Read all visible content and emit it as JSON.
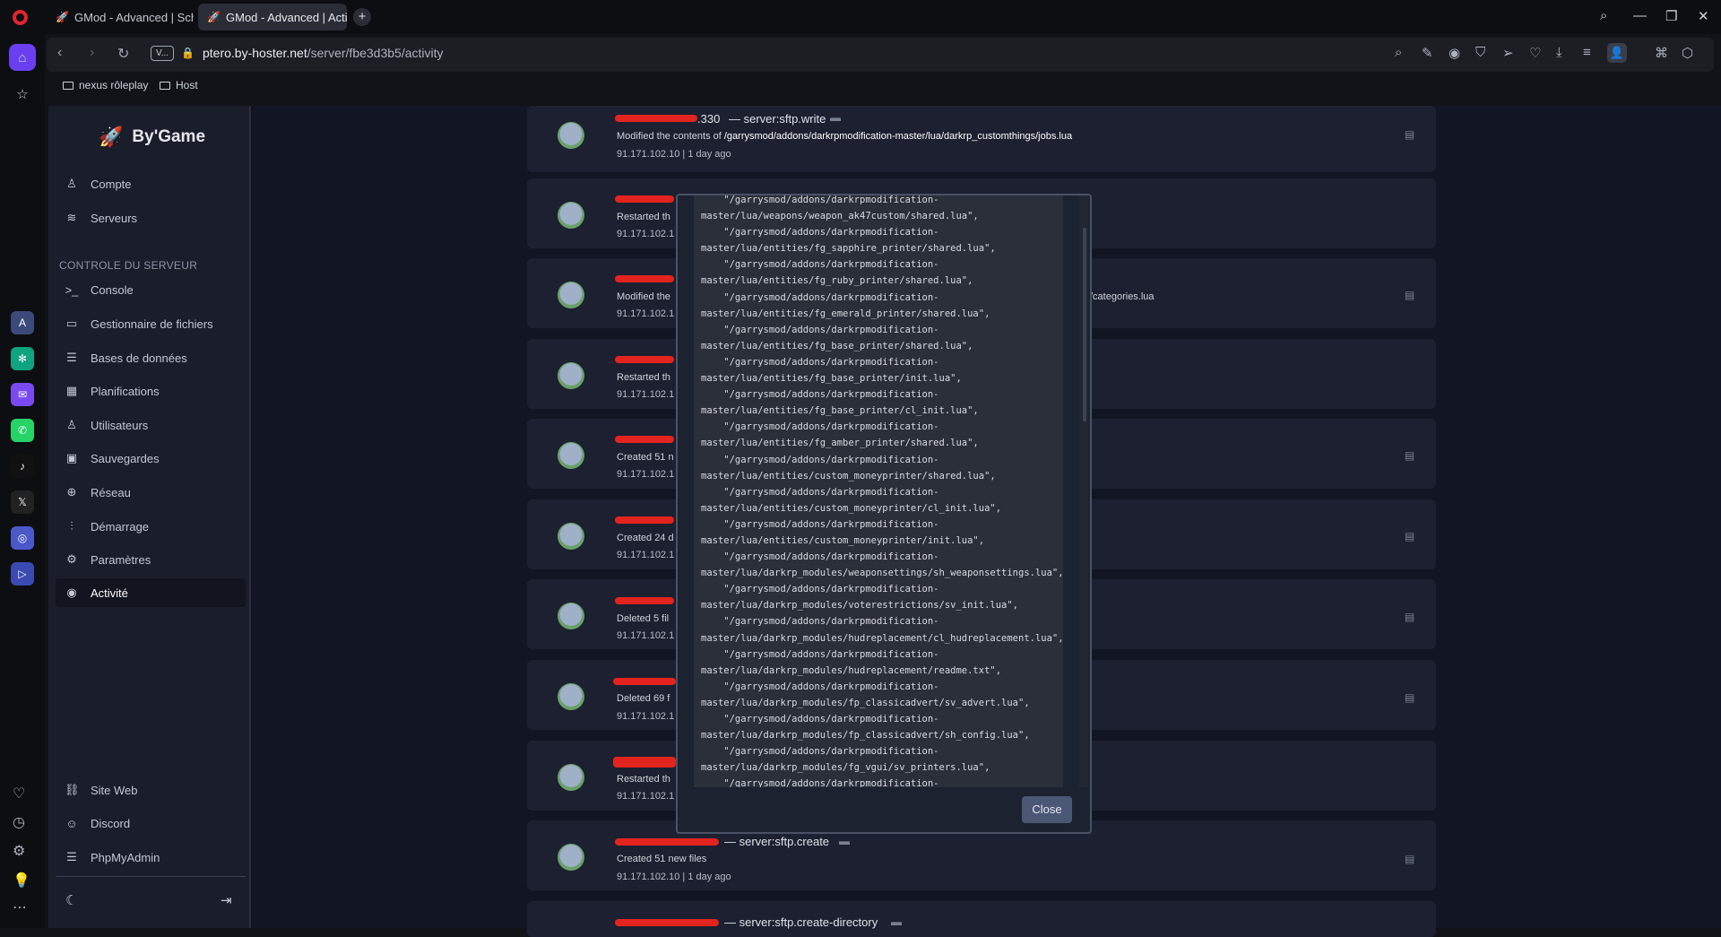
{
  "browser": {
    "tabs": [
      {
        "label": "GMod - Advanced | Sched"
      },
      {
        "label": "GMod - Advanced | Activ"
      }
    ],
    "new_tab": "+",
    "vpn_badge": "V...",
    "url_host": "ptero.by-hoster.net",
    "url_path": "/server/fbe3d3b5/activity",
    "bookmarks": [
      {
        "label": "nexus rôleplay"
      },
      {
        "label": "Host"
      }
    ]
  },
  "panel": {
    "brand": "By'Game",
    "nav_top": [
      {
        "label": "Compte"
      },
      {
        "label": "Serveurs"
      }
    ],
    "section_label": "CONTROLE DU SERVEUR",
    "nav_server": [
      {
        "label": "Console"
      },
      {
        "label": "Gestionnaire de fichiers"
      },
      {
        "label": "Bases de données"
      },
      {
        "label": "Planifications"
      },
      {
        "label": "Utilisateurs"
      },
      {
        "label": "Sauvegardes"
      },
      {
        "label": "Réseau"
      },
      {
        "label": "Démarrage"
      },
      {
        "label": "Paramètres"
      },
      {
        "label": "Activité"
      }
    ],
    "nav_bottom": [
      {
        "label": "Site Web"
      },
      {
        "label": "Discord"
      },
      {
        "label": "PhpMyAdmin"
      }
    ]
  },
  "activity": [
    {
      "user_suffix": ".330",
      "event": "— server:sftp.write",
      "desc_prefix": "Modified the contents of ",
      "desc_path": "/garrysmod/addons/darkrpmodification-master/lua/darkrp_customthings/jobs.lua",
      "meta": "91.171.102.10 | 1 day ago"
    },
    {
      "desc": "Restarted th",
      "meta": "91.171.102.1"
    },
    {
      "desc": "Modified the",
      "desc_tail": "/categories.lua",
      "meta": "91.171.102.1"
    },
    {
      "desc": "Restarted th",
      "meta": "91.171.102.1"
    },
    {
      "desc": "Created 51 n",
      "meta": "91.171.102.1"
    },
    {
      "desc": "Created 24 d",
      "meta": "91.171.102.1"
    },
    {
      "desc": "Deleted 5 fil",
      "meta": "91.171.102.1"
    },
    {
      "desc": "Deleted 69 f",
      "meta": "91.171.102.1"
    },
    {
      "desc": "Restarted th",
      "meta": "91.171.102.1"
    },
    {
      "user_suffix": ".330",
      "event": "— server:sftp.create",
      "desc": "Created 51 new files",
      "meta": "91.171.102.10 | 1 day ago"
    },
    {
      "event": "— server:sftp.create-directory"
    }
  ],
  "modal": {
    "code": "    \"/garrysmod/addons/darkrpmodification-\nmaster/lua/weapons/weapon_ak47custom/shared.lua\",\n    \"/garrysmod/addons/darkrpmodification-\nmaster/lua/entities/fg_sapphire_printer/shared.lua\",\n    \"/garrysmod/addons/darkrpmodification-\nmaster/lua/entities/fg_ruby_printer/shared.lua\",\n    \"/garrysmod/addons/darkrpmodification-\nmaster/lua/entities/fg_emerald_printer/shared.lua\",\n    \"/garrysmod/addons/darkrpmodification-\nmaster/lua/entities/fg_base_printer/shared.lua\",\n    \"/garrysmod/addons/darkrpmodification-\nmaster/lua/entities/fg_base_printer/init.lua\",\n    \"/garrysmod/addons/darkrpmodification-\nmaster/lua/entities/fg_base_printer/cl_init.lua\",\n    \"/garrysmod/addons/darkrpmodification-\nmaster/lua/entities/fg_amber_printer/shared.lua\",\n    \"/garrysmod/addons/darkrpmodification-\nmaster/lua/entities/custom_moneyprinter/shared.lua\",\n    \"/garrysmod/addons/darkrpmodification-\nmaster/lua/entities/custom_moneyprinter/cl_init.lua\",\n    \"/garrysmod/addons/darkrpmodification-\nmaster/lua/entities/custom_moneyprinter/init.lua\",\n    \"/garrysmod/addons/darkrpmodification-\nmaster/lua/darkrp_modules/weaponsettings/sh_weaponsettings.lua\",\n    \"/garrysmod/addons/darkrpmodification-\nmaster/lua/darkrp_modules/voterestrictions/sv_init.lua\",\n    \"/garrysmod/addons/darkrpmodification-\nmaster/lua/darkrp_modules/hudreplacement/cl_hudreplacement.lua\",\n    \"/garrysmod/addons/darkrpmodification-\nmaster/lua/darkrp_modules/hudreplacement/readme.txt\",\n    \"/garrysmod/addons/darkrpmodification-\nmaster/lua/darkrp_modules/fp_classicadvert/sv_advert.lua\",\n    \"/garrysmod/addons/darkrpmodification-\nmaster/lua/darkrp_modules/fp_classicadvert/sh_config.lua\",\n    \"/garrysmod/addons/darkrpmodification-\nmaster/lua/darkrp_modules/fg_vgui/sv_printers.lua\",\n    \"/garrysmod/addons/darkrpmodification-",
    "close_label": "Close"
  }
}
